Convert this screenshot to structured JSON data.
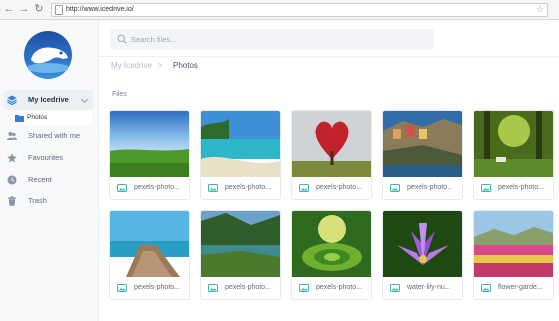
{
  "browser": {
    "url": "http://www.icedrive.io/"
  },
  "sidebar": {
    "items": [
      {
        "label": "My Icedrive",
        "icon": "stack-icon"
      },
      {
        "label": "Shared with me",
        "icon": "people-icon"
      },
      {
        "label": "Favourites",
        "icon": "star-icon"
      },
      {
        "label": "Recent",
        "icon": "clock-icon"
      },
      {
        "label": "Trash",
        "icon": "trash-icon"
      }
    ],
    "sub_item": {
      "label": "Photos",
      "icon": "folder-icon"
    }
  },
  "search": {
    "placeholder": "Search files..."
  },
  "breadcrumb": {
    "root": "My Icedrive",
    "separator": ">",
    "current": "Photos"
  },
  "section_title": "Files",
  "files": [
    {
      "name": "pexels-photo..."
    },
    {
      "name": "pexels-photo..."
    },
    {
      "name": "pexels-photo..."
    },
    {
      "name": "pexels-photo..."
    },
    {
      "name": "pexels-photo..."
    },
    {
      "name": "pexels-photo..."
    },
    {
      "name": "pexels-photo..."
    },
    {
      "name": "pexels-photo..."
    },
    {
      "name": "water-lily-nu..."
    },
    {
      "name": "flower-garde..."
    }
  ],
  "colors": {
    "accent": "#2f7fd8",
    "image_icon": "#3fb8b0"
  }
}
